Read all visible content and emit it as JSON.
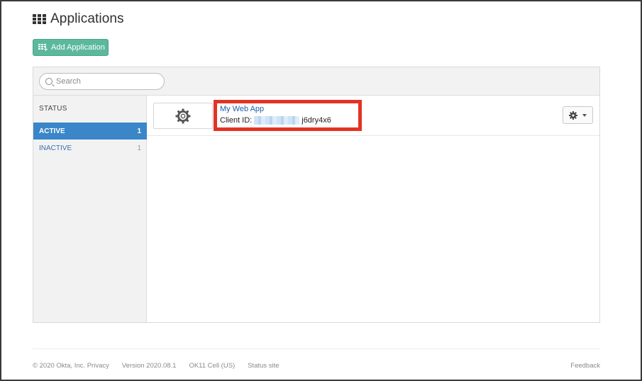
{
  "header": {
    "title": "Applications",
    "add_button_label": "Add Application"
  },
  "search": {
    "placeholder": "Search"
  },
  "sidebar": {
    "status_heading": "STATUS",
    "filters": [
      {
        "label": "ACTIVE",
        "count": "1",
        "selected": true
      },
      {
        "label": "INACTIVE",
        "count": "1",
        "selected": false
      }
    ]
  },
  "apps": [
    {
      "name": "My Web App",
      "client_id_label": "Client ID:",
      "client_id_visible_suffix": "j6dry4x6",
      "icon": "gear-icon"
    }
  ],
  "footer": {
    "copyright": "© 2020 Okta, Inc. Privacy",
    "version": "Version 2020.08.1",
    "cell": "OK11 Cell (US)",
    "status_site": "Status site",
    "feedback": "Feedback"
  },
  "colors": {
    "accent_green": "#5cb89c",
    "active_blue": "#3a86c8",
    "link_blue": "#1f5fa8",
    "highlight_red": "#e33324"
  }
}
